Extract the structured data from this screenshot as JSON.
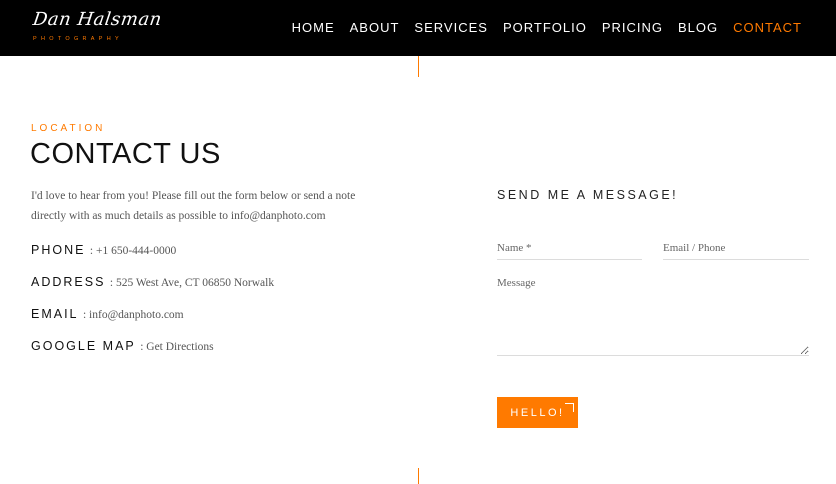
{
  "brand": {
    "logo_script": "Dan Halsman",
    "logo_sub": "PHOTOGRAPHY",
    "accent_color": "#ff7a00"
  },
  "nav": {
    "items": [
      "HOME",
      "ABOUT",
      "SERVICES",
      "PORTFOLIO",
      "PRICING",
      "BLOG",
      "CONTACT"
    ],
    "active": "CONTACT"
  },
  "contact": {
    "eyebrow": "LOCATION",
    "title": "CONTACT US",
    "intro": "I'd love to hear from you! Please fill out the form below or send a note directly with as much details as possible to info@danphoto.com",
    "phone_label": "PHONE",
    "phone_value": ": +1 650-444-0000",
    "address_label": "ADDRESS",
    "address_value": ": 525 West Ave, CT 06850 Norwalk",
    "email_label": "EMAIL",
    "email_value": ": info@danphoto.com",
    "map_label": "GOOGLE MAP",
    "map_value": ": Get Directions"
  },
  "form": {
    "title": "SEND ME A MESSAGE!",
    "name_placeholder": "Name *",
    "email_placeholder": "Email / Phone",
    "message_placeholder": "Message",
    "submit_label": "HELLO!"
  }
}
